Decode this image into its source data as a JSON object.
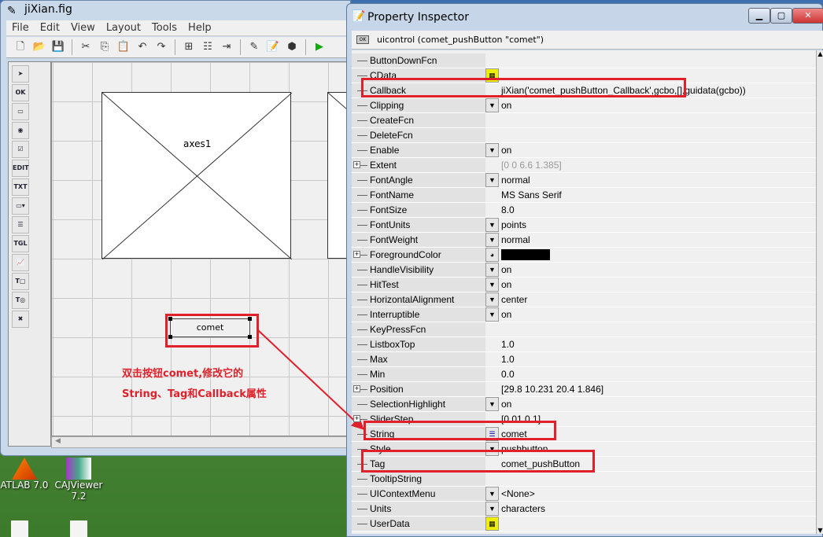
{
  "guide": {
    "title": "jiXian.fig",
    "menus": [
      "File",
      "Edit",
      "View",
      "Layout",
      "Tools",
      "Help"
    ],
    "toolbar_icons": [
      "new-file-icon",
      "open-folder-icon",
      "save-icon",
      "cut-icon",
      "copy-icon",
      "paste-icon",
      "undo-icon",
      "redo-icon",
      "align-icon",
      "menu-editor-icon",
      "tab-order-icon",
      "m-file-editor-icon",
      "property-inspector-icon",
      "object-browser-icon",
      "run-icon"
    ],
    "palette": [
      {
        "icon": "select-arrow-icon",
        "label": "➤"
      },
      {
        "icon": "pushbutton-icon",
        "label": "OK"
      },
      {
        "icon": "slider-icon",
        "label": "▭"
      },
      {
        "icon": "radiobutton-icon",
        "label": "◉"
      },
      {
        "icon": "checkbox-icon",
        "label": "☑"
      },
      {
        "icon": "edit-text-icon",
        "label": "EDIT"
      },
      {
        "icon": "static-text-icon",
        "label": "TXT"
      },
      {
        "icon": "popup-menu-icon",
        "label": "▭▾"
      },
      {
        "icon": "listbox-icon",
        "label": "☰"
      },
      {
        "icon": "toggle-button-icon",
        "label": "TGL"
      },
      {
        "icon": "axes-icon",
        "label": "📈"
      },
      {
        "icon": "panel-icon",
        "label": "T▢"
      },
      {
        "icon": "button-group-icon",
        "label": "T◎"
      },
      {
        "icon": "activex-icon",
        "label": "✖"
      }
    ],
    "axes_label": "axes1",
    "button_label": "comet"
  },
  "annotation": {
    "line1": "双击按钮comet,修改它的",
    "line2": "String、Tag和Callback属性",
    "color": "#e0202a"
  },
  "desktop": {
    "icons": [
      {
        "label": "ATLAB 7.0"
      },
      {
        "label": "CAJViewer 7.2"
      }
    ]
  },
  "inspector": {
    "title": "Property Inspector",
    "object": "uicontrol (comet_pushButton \"comet\")",
    "properties": [
      {
        "name": "ButtonDownFcn",
        "value": ""
      },
      {
        "name": "CData",
        "value": "",
        "icon": "grid"
      },
      {
        "name": "Callback",
        "value": "jiXian('comet_pushButton_Callback',gcbo,[],guidata(gcbo))",
        "highlight": true
      },
      {
        "name": "Clipping",
        "value": "on",
        "icon": "dropdown"
      },
      {
        "name": "CreateFcn",
        "value": ""
      },
      {
        "name": "DeleteFcn",
        "value": ""
      },
      {
        "name": "Enable",
        "value": "on",
        "icon": "dropdown"
      },
      {
        "name": "Extent",
        "value": "[0 0 6.6 1.385]",
        "expand": true,
        "readonly": true
      },
      {
        "name": "FontAngle",
        "value": "normal",
        "icon": "dropdown"
      },
      {
        "name": "FontName",
        "value": "MS Sans Serif"
      },
      {
        "name": "FontSize",
        "value": "8.0"
      },
      {
        "name": "FontUnits",
        "value": "points",
        "icon": "dropdown"
      },
      {
        "name": "FontWeight",
        "value": "normal",
        "icon": "dropdown"
      },
      {
        "name": "ForegroundColor",
        "value": "",
        "expand": true,
        "icon": "color",
        "swatch": "#000000"
      },
      {
        "name": "HandleVisibility",
        "value": "on",
        "icon": "dropdown"
      },
      {
        "name": "HitTest",
        "value": "on",
        "icon": "dropdown"
      },
      {
        "name": "HorizontalAlignment",
        "value": "center",
        "icon": "dropdown"
      },
      {
        "name": "Interruptible",
        "value": "on",
        "icon": "dropdown"
      },
      {
        "name": "KeyPressFcn",
        "value": ""
      },
      {
        "name": "ListboxTop",
        "value": "1.0"
      },
      {
        "name": "Max",
        "value": "1.0"
      },
      {
        "name": "Min",
        "value": "0.0"
      },
      {
        "name": "Position",
        "value": "[29.8 10.231 20.4 1.846]",
        "expand": true
      },
      {
        "name": "SelectionHighlight",
        "value": "on",
        "icon": "dropdown"
      },
      {
        "name": "SliderStep",
        "value": "[0.01 0.1]",
        "expand": true
      },
      {
        "name": "String",
        "value": "comet",
        "icon": "text",
        "highlight": true
      },
      {
        "name": "Style",
        "value": "pushbutton",
        "icon": "dropdown"
      },
      {
        "name": "Tag",
        "value": "comet_pushButton",
        "highlight": true
      },
      {
        "name": "TooltipString",
        "value": ""
      },
      {
        "name": "UIContextMenu",
        "value": "<None>",
        "icon": "dropdown"
      },
      {
        "name": "Units",
        "value": "characters",
        "icon": "dropdown"
      },
      {
        "name": "UserData",
        "value": "",
        "icon": "grid"
      }
    ]
  }
}
